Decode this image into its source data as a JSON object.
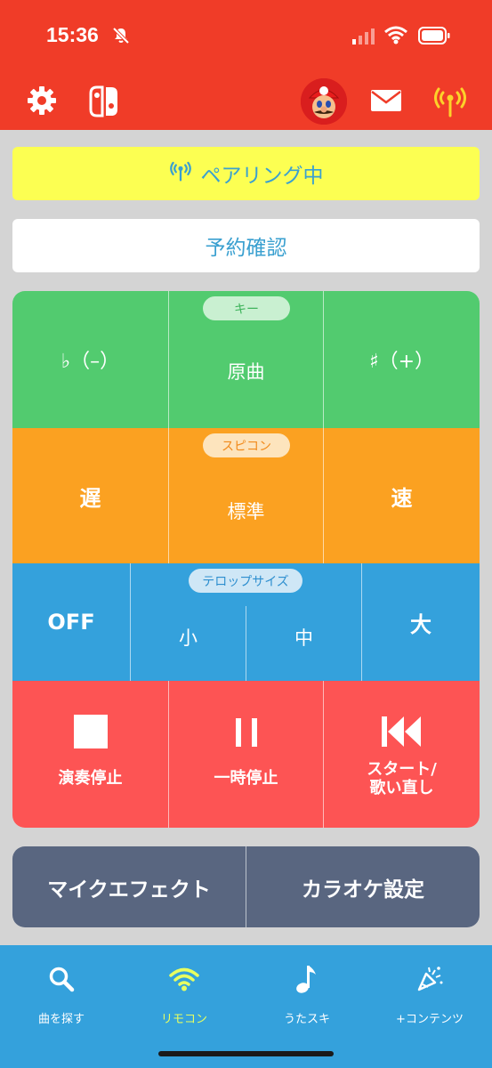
{
  "status": {
    "time": "15:36"
  },
  "pairing": {
    "label": "ペアリング中"
  },
  "reserve": {
    "label": "予約確認"
  },
  "key": {
    "section": "キー",
    "minus": "♭（–）",
    "original": "原曲",
    "plus": "♯（+）"
  },
  "speed": {
    "section": "スピコン",
    "slow": "遅",
    "normal": "標準",
    "fast": "速"
  },
  "telop": {
    "section": "テロップサイズ",
    "off": "OFF",
    "small": "小",
    "medium": "中",
    "large": "大"
  },
  "playback": {
    "stop": "演奏停止",
    "pause": "一時停止",
    "restart_line1": "スタート/",
    "restart_line2": "歌い直し"
  },
  "bottom_buttons": {
    "mic_effect": "マイクエフェクト",
    "karaoke_settings": "カラオケ設定"
  },
  "tabs": [
    {
      "label": "曲を探す",
      "icon": "search-icon"
    },
    {
      "label": "リモコン",
      "icon": "wifi-icon"
    },
    {
      "label": "うたスキ",
      "icon": "music-note-icon"
    },
    {
      "label": "+コンテンツ",
      "icon": "party-popper-icon"
    }
  ],
  "colors": {
    "header": "#f03c28",
    "pairing": "#fcff52",
    "key_row": "#52cb6f",
    "speed_row": "#fba121",
    "telop_row": "#34a1dc",
    "play_row": "#fd5454",
    "dark_bar": "#596680",
    "tab_active": "#e8ff60"
  }
}
